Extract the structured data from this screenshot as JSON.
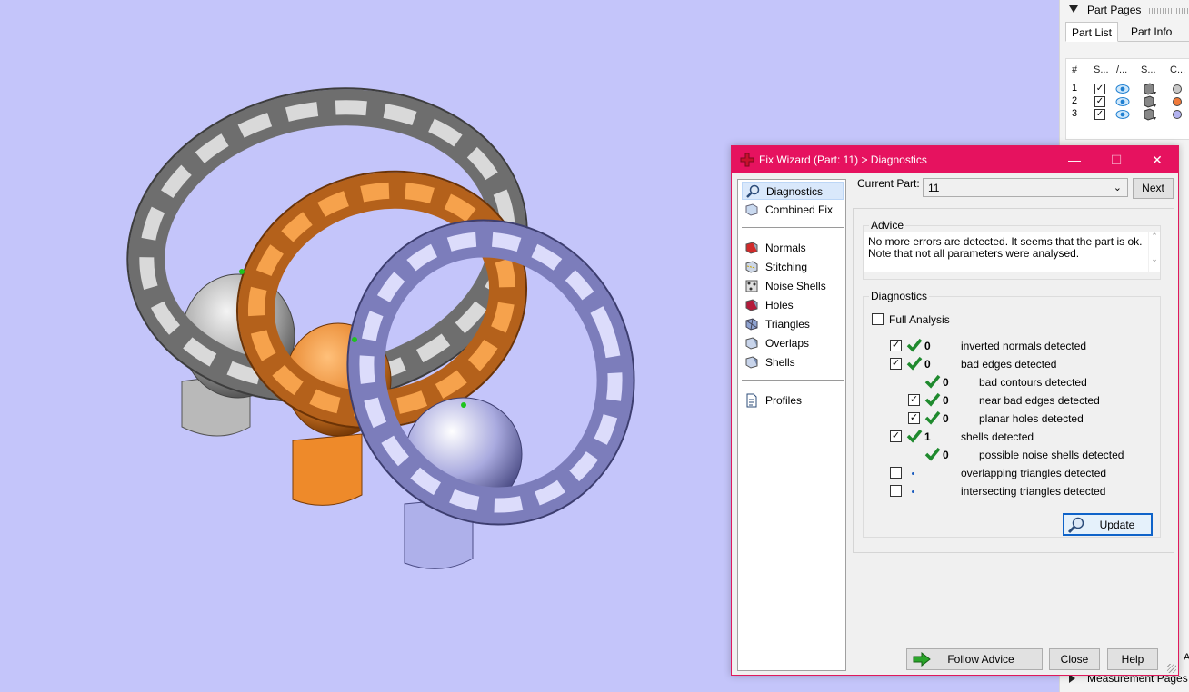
{
  "side_panel": {
    "part_pages_label": "Part Pages",
    "tabs": [
      {
        "label": "Part List"
      },
      {
        "label": "Part Info"
      }
    ],
    "columns": [
      "#",
      "S...",
      "/...",
      "S...",
      "C..."
    ],
    "rows": [
      {
        "num": "1",
        "color": "#c8c8c8"
      },
      {
        "num": "2",
        "color": "#f07a3a"
      },
      {
        "num": "3",
        "color": "#b3b3f0"
      }
    ],
    "measurement_pages_label": "Measurement Pages",
    "edge_letter": "A"
  },
  "dialog": {
    "title": "Fix Wizard (Part: 11) > Diagnostics",
    "window_buttons": {
      "minimize": "—",
      "maximize": "☐",
      "close": "✕"
    },
    "nav": [
      {
        "label": "Diagnostics",
        "icon": "magnifier-icon"
      },
      {
        "label": "Combined Fix",
        "icon": "combined-fix-icon"
      },
      {
        "label": "Normals",
        "icon": "normals-icon"
      },
      {
        "label": "Stitching",
        "icon": "stitching-icon"
      },
      {
        "label": "Noise Shells",
        "icon": "noise-shells-icon"
      },
      {
        "label": "Holes",
        "icon": "holes-icon"
      },
      {
        "label": "Triangles",
        "icon": "triangles-icon"
      },
      {
        "label": "Overlaps",
        "icon": "overlaps-icon"
      },
      {
        "label": "Shells",
        "icon": "shells-icon"
      },
      {
        "label": "Profiles",
        "icon": "profiles-icon"
      }
    ],
    "current_part_label": "Current Part:",
    "current_part_value": "11",
    "next_label": "Next",
    "advice_title": "Advice",
    "advice_line1": "No more errors are detected. It seems that the part is ok.",
    "advice_line2": "Note that not all parameters were analysed.",
    "diagnostics_title": "Diagnostics",
    "full_analysis_label": "Full Analysis",
    "diagnostics": [
      {
        "checked": true,
        "count": "0",
        "label": "inverted normals detected",
        "level": 0
      },
      {
        "checked": true,
        "count": "0",
        "label": "bad edges detected",
        "level": 0
      },
      {
        "checked": null,
        "count": "0",
        "label": "bad contours detected",
        "level": 1
      },
      {
        "checked": true,
        "count": "0",
        "label": "near bad edges detected",
        "level": 1
      },
      {
        "checked": true,
        "count": "0",
        "label": "planar holes detected",
        "level": 1
      },
      {
        "checked": true,
        "count": "1",
        "label": "shells detected",
        "level": 0
      },
      {
        "checked": null,
        "count": "0",
        "label": "possible noise shells detected",
        "level": 1
      },
      {
        "checked": false,
        "count": "",
        "label": "overlapping triangles detected",
        "level": 0
      },
      {
        "checked": false,
        "count": "",
        "label": "intersecting triangles detected",
        "level": 0
      }
    ],
    "update_label": "Update",
    "follow_advice_label": "Follow Advice",
    "close_label": "Close",
    "help_label": "Help",
    "colors": {
      "titlebar": "#e6125f",
      "check_green": "#1f8a2e",
      "viewport_bg": "#c4c5fa"
    }
  }
}
